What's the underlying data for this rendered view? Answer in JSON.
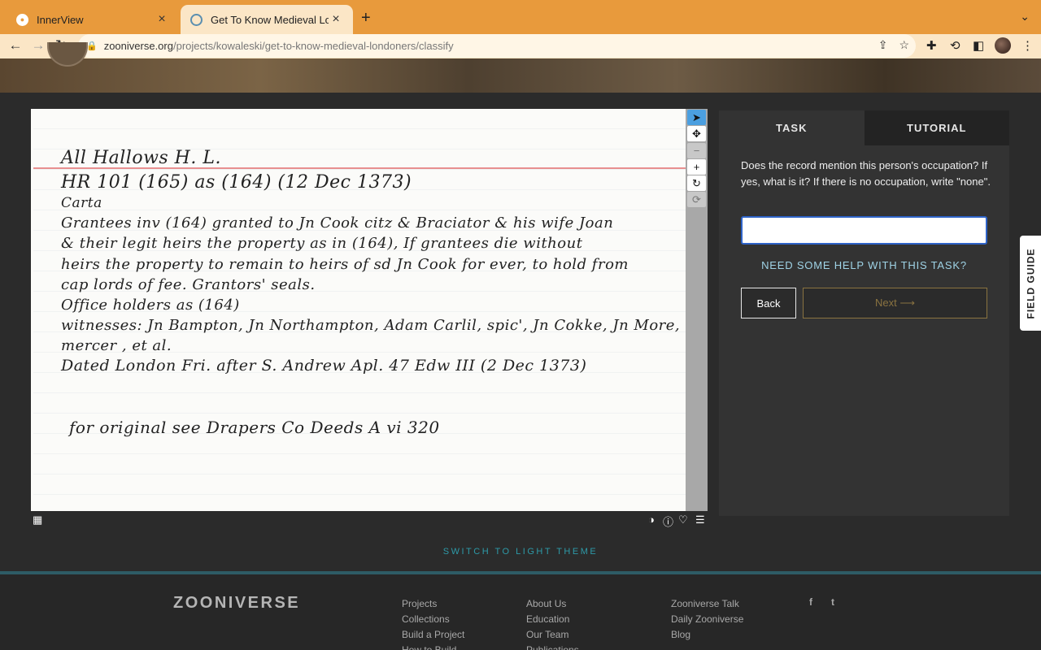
{
  "browser": {
    "tabs": [
      {
        "title": "InnerView",
        "active": false
      },
      {
        "title": "Get To Know Medieval Londoners",
        "active": true
      }
    ],
    "new_tab_icon": "plus",
    "address": {
      "host": "zooniverse.org",
      "path": "/projects/kowaleski/get-to-know-medieval-londoners/classify"
    }
  },
  "subject": {
    "lines": [
      "All Hallows  H. L.",
      "HR 101 (165)                  as (164)     (12 Dec 1373)",
      "Carta",
      "Grantees  inv  (164)  granted to  Jn Cook  citz & Braciator  & his wife Joan",
      "& their legit heirs    the  property  as  in   (164),   If grantees die without",
      "heirs the property to remain  to heirs of sd Jn Cook  for ever,  to hold from",
      "cap lords of fee.  Grantors' seals.",
      "Office holders   as  (164)",
      "witnesses:  Jn Bampton,  Jn Northampton,  Adam Carlil, spic',  Jn Cokke, Jn More,",
      "mercer ,   et al.",
      "Dated  London  Fri. after  S. Andrew  Apl.  47 Edw III  (2 Dec 1373)",
      "for original see     Drapers Co Deeds  A vi 320"
    ]
  },
  "task": {
    "tabs": {
      "task": "TASK",
      "tutorial": "TUTORIAL"
    },
    "question": "Does the record mention this person's occupation? If yes, what is it? If there is no occupation, write \"none\".",
    "answer_value": "",
    "help": "NEED SOME HELP WITH THIS TASK?",
    "back": "Back",
    "next": "Next ⟶"
  },
  "field_guide": "FIELD GUIDE",
  "switch_theme": "SWITCH TO LIGHT THEME",
  "footer": {
    "logo": "ZOONIVERSE",
    "col1": [
      "Projects",
      "Collections",
      "Build a Project",
      "How to Build"
    ],
    "col2": [
      "About Us",
      "Education",
      "Our Team",
      "Publications"
    ],
    "col3": [
      "Zooniverse Talk",
      "Daily Zooniverse",
      "Blog"
    ],
    "social": [
      "f",
      "t"
    ]
  }
}
